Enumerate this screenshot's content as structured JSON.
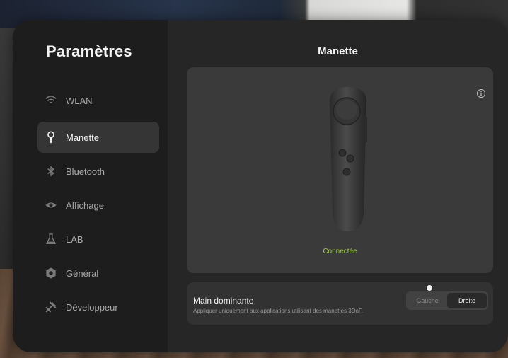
{
  "app": {
    "title": "Paramètres"
  },
  "sidebar": {
    "items": [
      {
        "label": "WLAN",
        "icon": "wifi-icon",
        "active": false
      },
      {
        "label": "Manette",
        "icon": "controller-icon",
        "active": true
      },
      {
        "label": "Bluetooth",
        "icon": "bluetooth-icon",
        "active": false
      },
      {
        "label": "Affichage",
        "icon": "eye-icon",
        "active": false
      },
      {
        "label": "LAB",
        "icon": "flask-icon",
        "active": false
      },
      {
        "label": "Général",
        "icon": "gear-icon",
        "active": false
      },
      {
        "label": "Développeur",
        "icon": "tools-icon",
        "active": false
      }
    ]
  },
  "main": {
    "title": "Manette",
    "controller": {
      "status": "Connectée",
      "status_color": "#9acd32"
    },
    "dominant_hand": {
      "title": "Main dominante",
      "description": "Appliquer uniquement aux applications utilisant des manettes 3DoF.",
      "options": [
        "Gauche",
        "Droite"
      ],
      "selected": "Droite"
    }
  },
  "colors": {
    "window_bg": "#262626",
    "sidebar_bg": "#1d1d1d",
    "card_bg": "#3a3a3a",
    "accent_status": "#9acd32"
  }
}
